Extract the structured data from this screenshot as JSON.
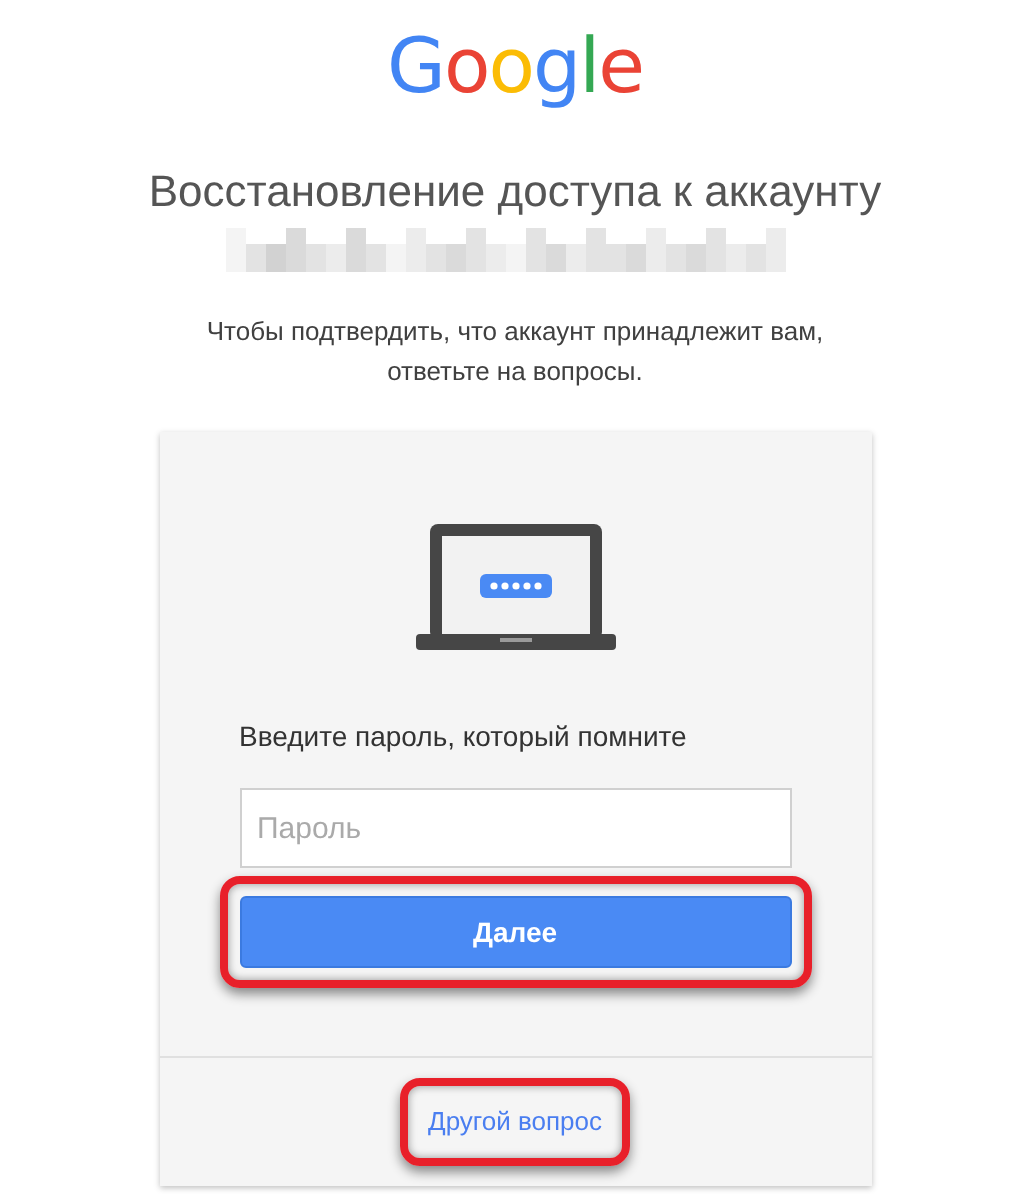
{
  "logo": {
    "text": "Google"
  },
  "title": "Восстановление доступа к аккаунту",
  "subtitle": "Чтобы подтвердить, что аккаунт принадлежит вам, ответьте на вопросы.",
  "card": {
    "prompt": "Введите пароль, который помните",
    "password_field": {
      "placeholder": "Пароль"
    },
    "next_button": {
      "label": "Далее",
      "highlighted": true
    },
    "other_question_link": {
      "label": "Другой вопрос",
      "highlighted": true
    }
  }
}
